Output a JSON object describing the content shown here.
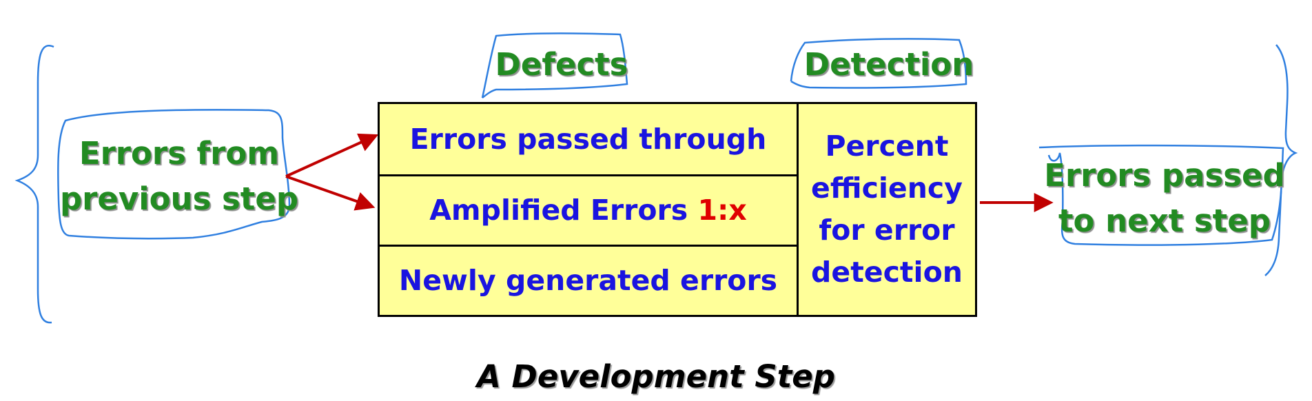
{
  "headers": {
    "defects": "Defects",
    "detection": "Detection"
  },
  "input": {
    "line1": "Errors from",
    "line2": "previous step"
  },
  "rows": [
    {
      "text": "Errors passed through"
    },
    {
      "text": "Amplified Errors ",
      "ratio": "1:x"
    },
    {
      "text": "Newly generated errors"
    }
  ],
  "detection": {
    "lines": [
      "Percent",
      "efficiency",
      "for error",
      "detection"
    ]
  },
  "output": {
    "line1": "Errors passed",
    "line2": "to next step"
  },
  "caption": "A Development Step",
  "colors": {
    "label_green": "#228b22",
    "cell_blue": "#1a14e0",
    "ratio_red": "#e00000",
    "cell_fill": "#ffff99",
    "arrow_red": "#c00000",
    "annotation_blue": "#2f7fe0"
  }
}
